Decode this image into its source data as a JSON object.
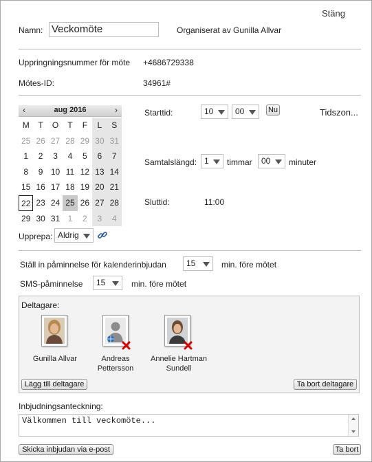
{
  "header": {
    "close_label": "Stäng"
  },
  "meeting": {
    "name_label": "Namn:",
    "name_value": "Veckomöte",
    "organizer": "Organiserat av Gunilla Allvar",
    "dial_label": "Uppringningsnummer för möte",
    "dial_value": "+4686729338",
    "id_label": "Mötes-ID:",
    "id_value": "34961#"
  },
  "calendar": {
    "month_title": "aug 2016",
    "prev": "‹",
    "next": "›",
    "weekdays": [
      "M",
      "T",
      "O",
      "T",
      "F",
      "L",
      "S"
    ],
    "weeks": [
      [
        "25",
        "26",
        "27",
        "28",
        "29",
        "30",
        "31"
      ],
      [
        "1",
        "2",
        "3",
        "4",
        "5",
        "6",
        "7"
      ],
      [
        "8",
        "9",
        "10",
        "11",
        "12",
        "13",
        "14"
      ],
      [
        "15",
        "16",
        "17",
        "18",
        "19",
        "20",
        "21"
      ],
      [
        "22",
        "23",
        "24",
        "25",
        "26",
        "27",
        "28"
      ],
      [
        "29",
        "30",
        "31",
        "1",
        "2",
        "3",
        "4"
      ]
    ],
    "today": "22",
    "selected": "25"
  },
  "time": {
    "start_label": "Starttid:",
    "start_hour": "10",
    "start_min": "00",
    "now_button": "Nu",
    "timezone_link": "Tidszon...",
    "duration_label": "Samtalslängd:",
    "duration_hours": "1",
    "hours_unit": "timmar",
    "duration_minutes": "00",
    "minutes_unit": "minuter",
    "end_label": "Sluttid:",
    "end_value": "11:00"
  },
  "repeat": {
    "label": "Upprepa:",
    "value": "Aldrig"
  },
  "reminders": {
    "calendar_label": "Ställ in påminnelse för kalenderinbjudan",
    "calendar_value": "15",
    "calendar_unit": "min. före mötet",
    "sms_label": "SMS-påminnelse",
    "sms_value": "15",
    "sms_unit": "min. före mötet"
  },
  "participants": {
    "label": "Deltagare:",
    "people": [
      {
        "name": "Gunilla Allvar",
        "removable": false
      },
      {
        "name_line1": "Andreas",
        "name_line2": "Pettersson",
        "removable": true
      },
      {
        "name_line1": "Annelie Hartman",
        "name_line2": "Sundell",
        "removable": true
      }
    ],
    "add_button": "Lägg till deltagare",
    "remove_button": "Ta bort deltagare"
  },
  "note": {
    "label": "Inbjudningsanteckning:",
    "value": "Välkommen till veckomöte..."
  },
  "footer": {
    "send_button": "Skicka inbjudan via e-post",
    "delete_button": "Ta bort"
  },
  "colors": {
    "remove_red": "#d40000",
    "border": "#bdbdbd",
    "panel_bg": "#f3f3f3"
  }
}
